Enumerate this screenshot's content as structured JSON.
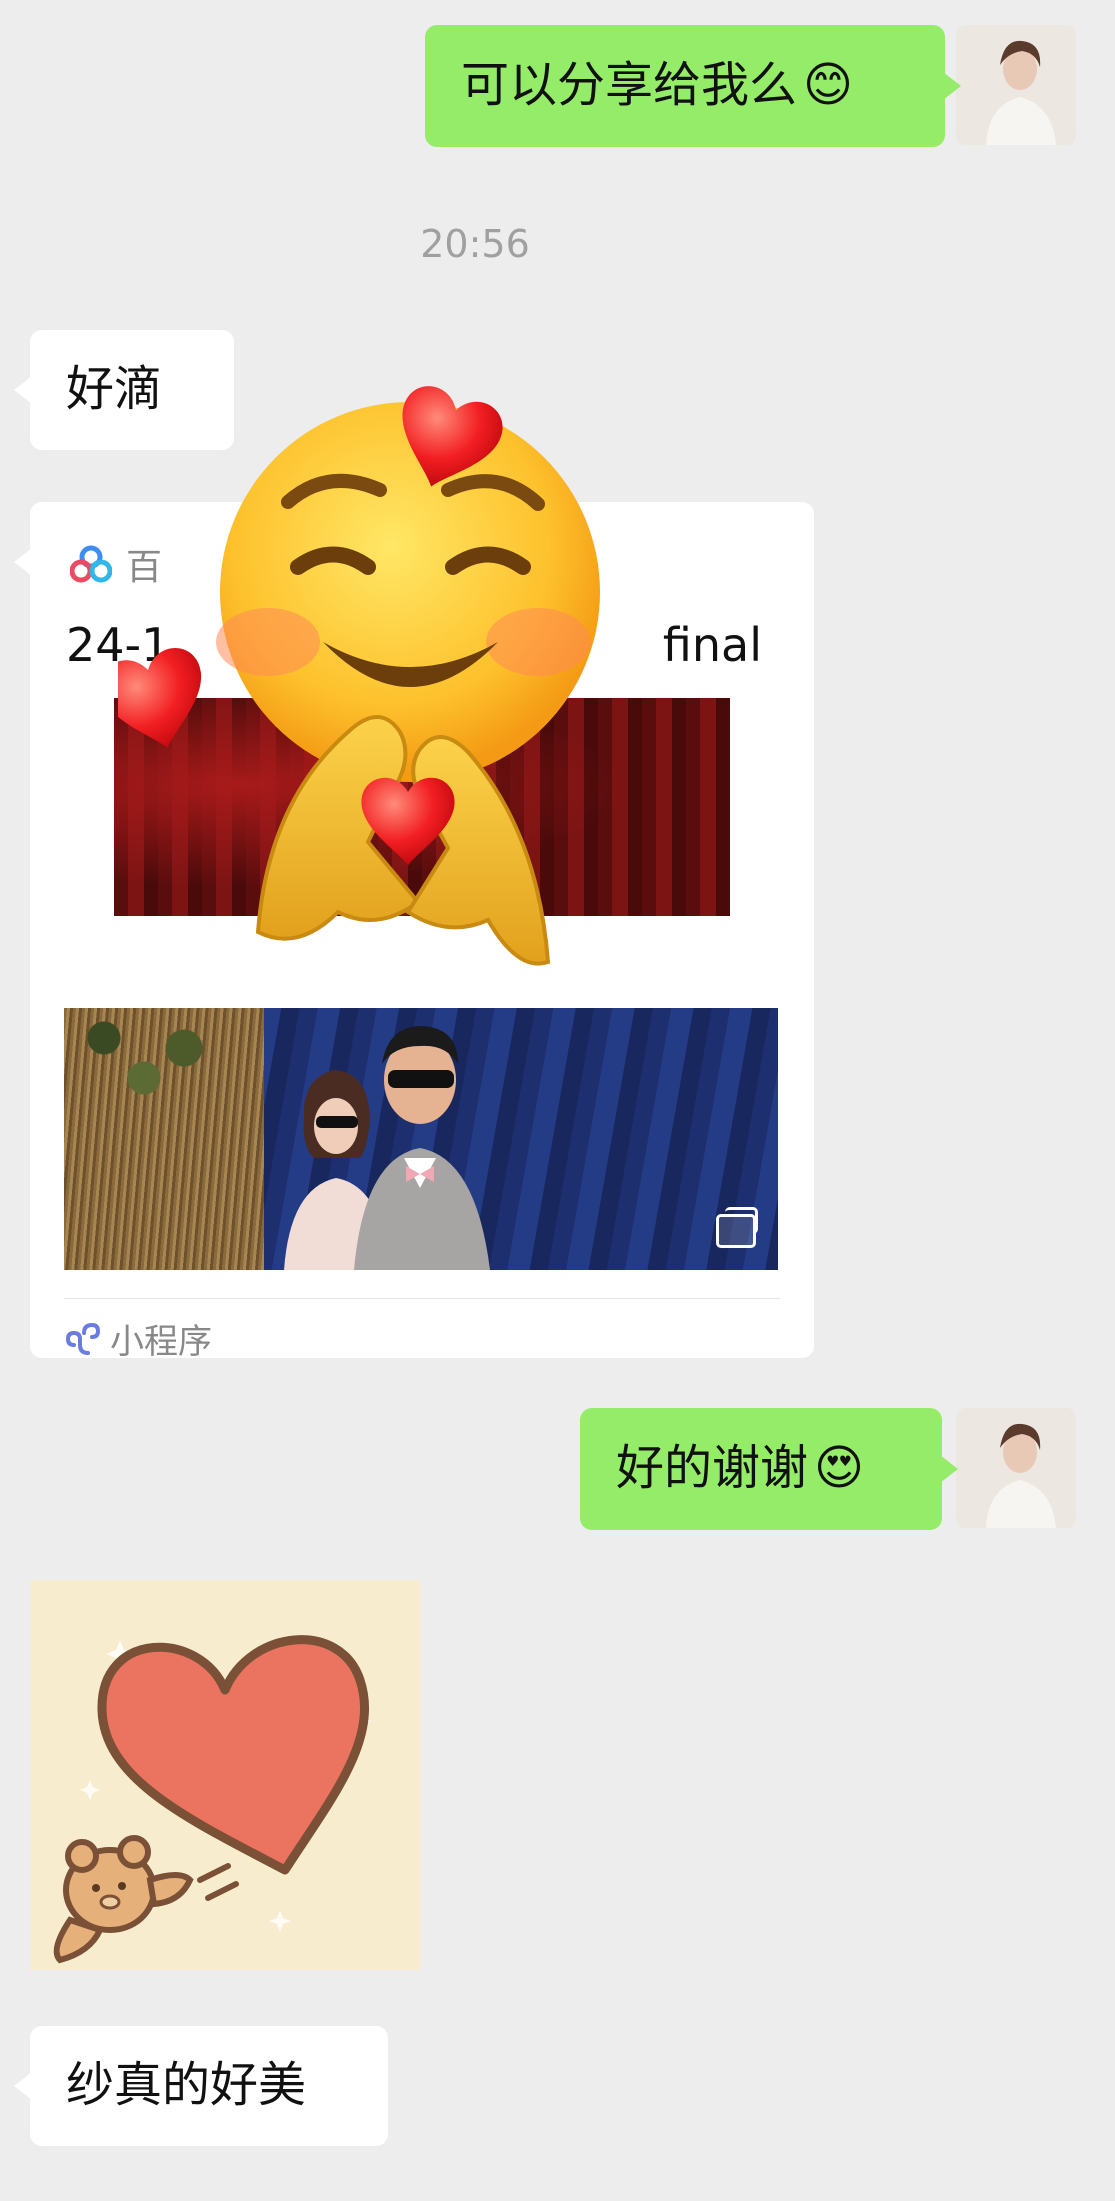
{
  "messages": {
    "msg1": {
      "text": "可以分享给我么",
      "emoji": "😊"
    },
    "timestamp": "20:56",
    "msg2": {
      "text": "好滴"
    },
    "msg4": {
      "text": "好的谢谢",
      "emoji": "😍"
    },
    "msg6": {
      "text": "纱真的好美"
    }
  },
  "card": {
    "source_name": "百",
    "title_start": "24-1",
    "title_end": "final",
    "footer_label": "小程序",
    "source_icon": "baidu-netdisk-icon",
    "footer_icon": "mini-program-icon",
    "gallery_icon": "multi-image-icon"
  },
  "icons": {
    "sticker": "smiling-face-with-hearts-and-heart-hands",
    "heart_sticker": "heart-with-bear"
  },
  "colors": {
    "chat_bg": "#ededed",
    "bubble_green": "#95ec69",
    "bubble_white": "#ffffff"
  }
}
